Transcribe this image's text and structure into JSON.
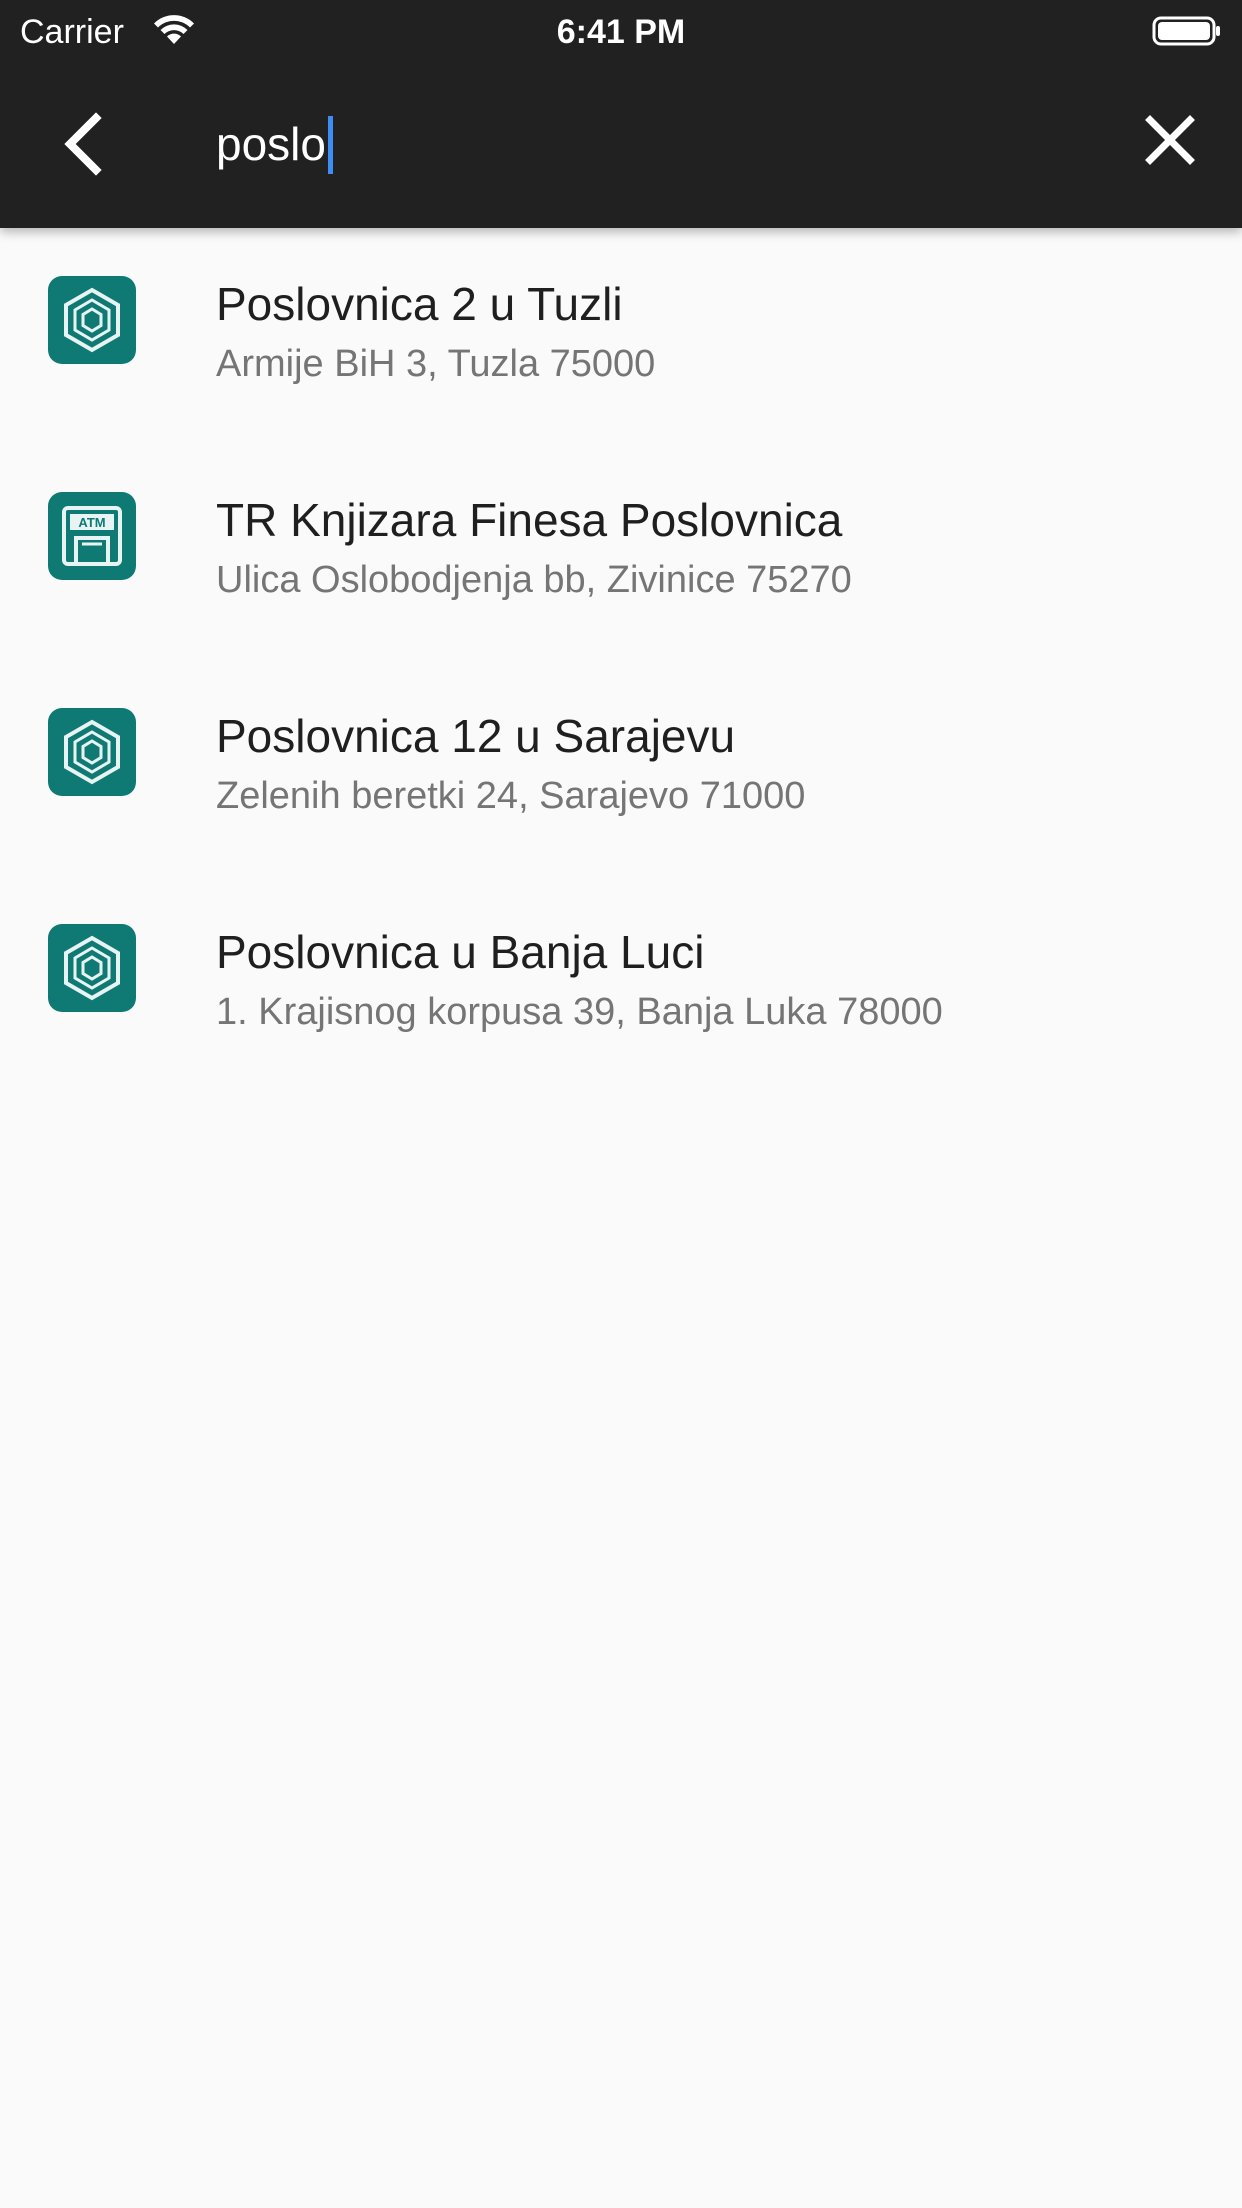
{
  "status_bar": {
    "carrier": "Carrier",
    "time": "6:41 PM"
  },
  "search": {
    "query": "poslo",
    "back_icon": "chevron-left-icon",
    "clear_icon": "close-icon"
  },
  "results": [
    {
      "icon": "branch-icon",
      "title": "Poslovnica 2 u Tuzli",
      "address": "Armije BiH 3, Tuzla 75000"
    },
    {
      "icon": "atm-icon",
      "title": "TR Knjizara Finesa Poslovnica",
      "address": "Ulica Oslobodjenja bb, Zivinice 75270"
    },
    {
      "icon": "branch-icon",
      "title": "Poslovnica 12 u Sarajevu",
      "address": "Zelenih beretki 24, Sarajevo 71000"
    },
    {
      "icon": "branch-icon",
      "title": "Poslovnica u Banja Luci",
      "address": "1. Krajisnog korpusa 39, Banja Luka 78000"
    }
  ],
  "colors": {
    "app_bar": "#212121",
    "background": "#fafafa",
    "icon_bg": "#0f7a74",
    "caret": "#3d8df5",
    "title_text": "#1f1f1f",
    "address_text": "#757575"
  }
}
